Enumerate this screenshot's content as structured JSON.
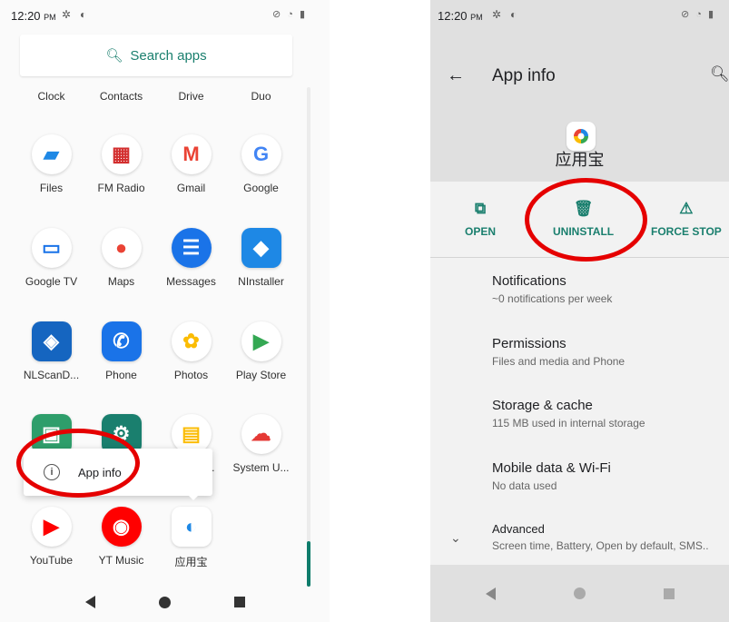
{
  "left": {
    "status": {
      "time": "12:20",
      "ampm": "PM",
      "icons": [
        "settings-icon",
        "notification-icon"
      ],
      "right_icons": [
        "no-sim-icon",
        "wifi-icon",
        "battery-icon"
      ]
    },
    "search": {
      "label": "Search apps",
      "icon": "search-icon"
    },
    "rows": [
      [
        {
          "label": "Clock"
        },
        {
          "label": "Contacts"
        },
        {
          "label": "Drive"
        },
        {
          "label": "Duo"
        }
      ],
      [
        {
          "label": "Files",
          "color": "#4285f4",
          "glyph": "▰"
        },
        {
          "label": "FM Radio",
          "color": "#d32f2f",
          "glyph": "▦"
        },
        {
          "label": "Gmail",
          "color": "#ffffff",
          "glyph": "M"
        },
        {
          "label": "Google",
          "color": "#ffffff",
          "glyph": "G"
        }
      ],
      [
        {
          "label": "Google TV",
          "color": "#ffffff",
          "glyph": "▭"
        },
        {
          "label": "Maps",
          "color": "#ffffff",
          "glyph": "●"
        },
        {
          "label": "Messages",
          "color": "#1a73e8",
          "glyph": "☰"
        },
        {
          "label": "NInstaller",
          "color": "#1e88e5",
          "glyph": "◆"
        }
      ],
      [
        {
          "label": "NLScanD...",
          "color": "#1565c0",
          "glyph": "◈"
        },
        {
          "label": "Phone",
          "color": "#1a73e8",
          "glyph": "✆"
        },
        {
          "label": "Photos",
          "color": "#ffffff",
          "glyph": "✿"
        },
        {
          "label": "Play Store",
          "color": "#ffffff",
          "glyph": "▶"
        }
      ],
      [
        {
          "label": "",
          "color": "#2e9e6b",
          "glyph": "▣"
        },
        {
          "label": "",
          "color": "#1a7f6e",
          "glyph": "⚙"
        },
        {
          "label": "",
          "color": "#ffffff",
          "glyph": "▤"
        },
        {
          "label": "System U...",
          "color": "#ffffff",
          "glyph": "☁"
        }
      ],
      [
        {
          "label": "YouTube",
          "color": "#ffffff",
          "glyph": "▶"
        },
        {
          "label": "YT Music",
          "color": "#ff0000",
          "glyph": "◉"
        },
        {
          "label": "应用宝",
          "color": "#ffffff",
          "glyph": "◐"
        }
      ]
    ],
    "popup": {
      "label": "App info",
      "icon": "info-icon"
    },
    "partial_label": "..."
  },
  "right": {
    "status": {
      "time": "12:20",
      "ampm": "PM"
    },
    "title": "App info",
    "app_name": "应用宝",
    "actions": [
      {
        "label": "OPEN",
        "icon": "open-icon"
      },
      {
        "label": "UNINSTALL",
        "icon": "trash-icon"
      },
      {
        "label": "FORCE STOP",
        "icon": "warning-icon"
      }
    ],
    "settings": [
      {
        "title": "Notifications",
        "subtitle": "~0 notifications per week"
      },
      {
        "title": "Permissions",
        "subtitle": "Files and media and Phone"
      },
      {
        "title": "Storage & cache",
        "subtitle": "115 MB used in internal storage"
      },
      {
        "title": "Mobile data & Wi-Fi",
        "subtitle": "No data used"
      },
      {
        "title": "Advanced",
        "subtitle": "Screen time, Battery, Open by default, SMS.."
      }
    ]
  },
  "colors": {
    "accent": "#1a7f6e",
    "highlight": "#e50000"
  }
}
